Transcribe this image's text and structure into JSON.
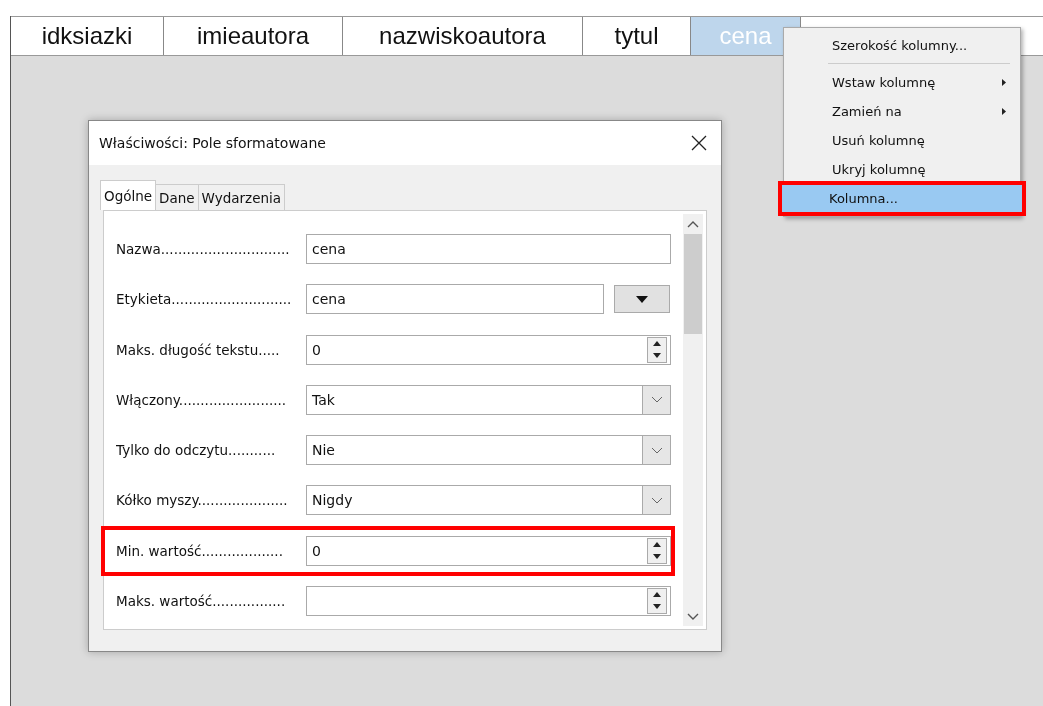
{
  "columns": [
    {
      "label": "idksiazki",
      "selected": false
    },
    {
      "label": "imieautora",
      "selected": false
    },
    {
      "label": "nazwiskoautora",
      "selected": false
    },
    {
      "label": "tytul",
      "selected": false
    },
    {
      "label": "cena",
      "selected": true
    }
  ],
  "context_menu": {
    "items": [
      {
        "label": "Szerokość kolumny...",
        "submenu": false,
        "highlighted": false,
        "divider_after": true
      },
      {
        "label": "Wstaw kolumnę",
        "submenu": true,
        "highlighted": false,
        "divider_after": false
      },
      {
        "label": "Zamień na",
        "submenu": true,
        "highlighted": false,
        "divider_after": false
      },
      {
        "label": "Usuń kolumnę",
        "submenu": false,
        "highlighted": false,
        "divider_after": false
      },
      {
        "label": "Ukryj kolumnę",
        "submenu": false,
        "highlighted": false,
        "divider_after": false
      },
      {
        "label": "Kolumna...",
        "submenu": false,
        "highlighted": true,
        "divider_after": false
      }
    ]
  },
  "dialog": {
    "title": "Właściwości: Pole sformatowane",
    "tabs": [
      {
        "label": "Ogólne",
        "selected": true
      },
      {
        "label": "Dane",
        "selected": false
      },
      {
        "label": "Wydarzenia",
        "selected": false
      }
    ],
    "properties": [
      {
        "label": "Nazwa..............................",
        "kind": "text",
        "value": "cena",
        "highlighted": false
      },
      {
        "label": "Etykieta............................",
        "kind": "text_button",
        "value": "cena",
        "highlighted": false
      },
      {
        "label": "Maks. długość tekstu.....",
        "kind": "spin",
        "value": "0",
        "highlighted": false
      },
      {
        "label": "Włączony.........................",
        "kind": "select",
        "value": "Tak",
        "highlighted": false
      },
      {
        "label": "Tylko do odczytu...........",
        "kind": "select",
        "value": "Nie",
        "highlighted": false
      },
      {
        "label": "Kółko myszy.....................",
        "kind": "select",
        "value": "Nigdy",
        "highlighted": false
      },
      {
        "label": "Min. wartość...................",
        "kind": "spin",
        "value": "0",
        "highlighted": true
      },
      {
        "label": "Maks. wartość.................",
        "kind": "spin",
        "highlighted": false
      }
    ]
  }
}
